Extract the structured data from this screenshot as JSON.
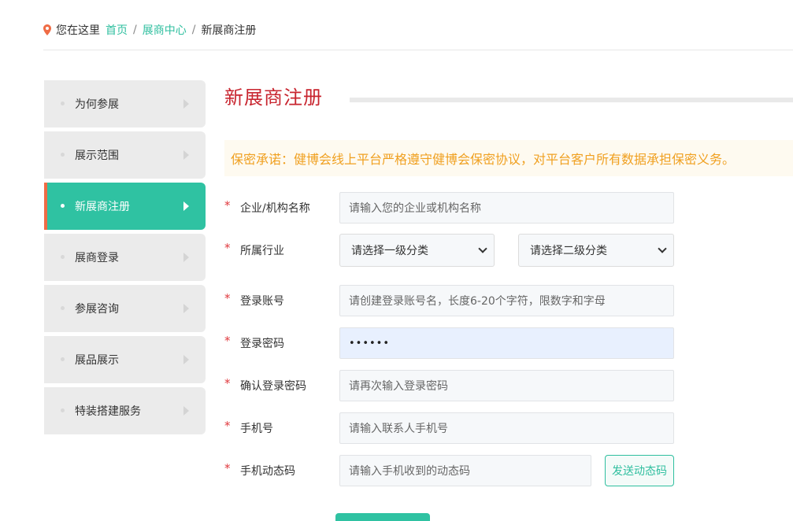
{
  "breadcrumb": {
    "prefix": "您在这里",
    "home": "首页",
    "center": "展商中心",
    "current": "新展商注册",
    "sep": "/"
  },
  "sidebar": {
    "items": [
      {
        "label": "为何参展",
        "active": false
      },
      {
        "label": "展示范围",
        "active": false
      },
      {
        "label": "新展商注册",
        "active": true
      },
      {
        "label": "展商登录",
        "active": false
      },
      {
        "label": "参展咨询",
        "active": false
      },
      {
        "label": "展品展示",
        "active": false
      },
      {
        "label": "特装搭建服务",
        "active": false
      }
    ]
  },
  "main": {
    "title": "新展商注册",
    "notice": "保密承诺：健博会线上平台严格遵守健博会保密协议，对平台客户所有数据承担保密义务。"
  },
  "form": {
    "required_mark": "*",
    "company": {
      "label": "企业/机构名称",
      "placeholder": "请输入您的企业或机构名称"
    },
    "industry": {
      "label": "所属行业",
      "primary": "请选择一级分类",
      "secondary": "请选择二级分类"
    },
    "account": {
      "label": "登录账号",
      "placeholder": "请创建登录账号名，长度6-20个字符，限数字和字母"
    },
    "password": {
      "label": "登录密码",
      "value": "••••••"
    },
    "confirm": {
      "label": "确认登录密码",
      "placeholder": "请再次输入登录密码"
    },
    "phone": {
      "label": "手机号",
      "placeholder": "请输入联系人手机号"
    },
    "code": {
      "label": "手机动态码",
      "placeholder": "请输入手机收到的动态码",
      "send_label": "发送动态码"
    }
  },
  "colors": {
    "accent": "#2fc2a2",
    "title_red": "#c8252f",
    "notice_orange": "#f0a020",
    "active_marker": "#ef6c45"
  }
}
